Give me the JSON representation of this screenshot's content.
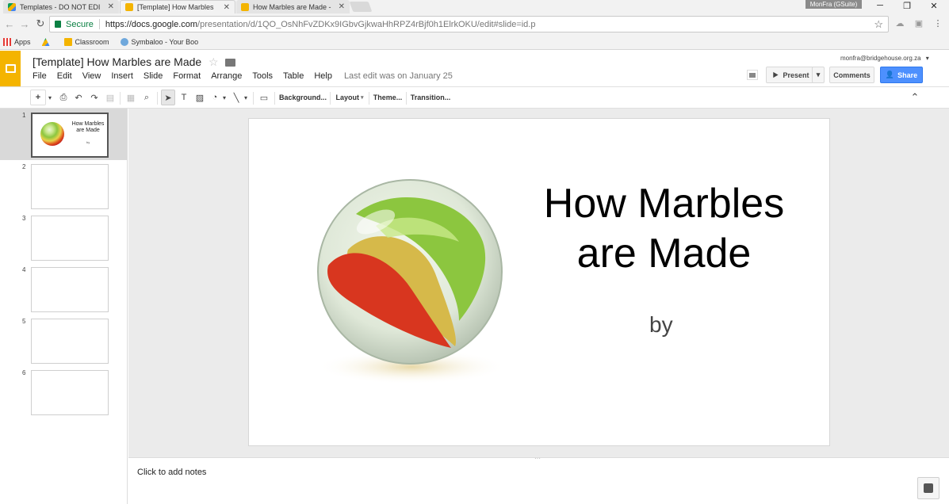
{
  "browser": {
    "tabs": [
      {
        "title": "Templates - DO NOT EDI",
        "active": false
      },
      {
        "title": "[Template] How Marbles",
        "active": true
      },
      {
        "title": "How Marbles are Made -",
        "active": false
      }
    ],
    "profile_name": "MonFra (GSuite)",
    "url_secure_label": "Secure",
    "url_host": "https://docs.google.com",
    "url_path": "/presentation/d/1QO_OsNhFvZDKx9IGbvGjkwaHhRPZ4rBjf0h1ElrkOKU/edit#slide=id.p",
    "bookmarks": [
      {
        "label": "Apps",
        "icon": "apps-grid-icon"
      },
      {
        "label": "",
        "icon": "google-drive-icon"
      },
      {
        "label": "Classroom",
        "icon": "classroom-icon"
      },
      {
        "label": "Symbaloo - Your Boo",
        "icon": "symbaloo-icon"
      }
    ]
  },
  "doc": {
    "title": "[Template] How Marbles are Made",
    "menu": [
      "File",
      "Edit",
      "View",
      "Insert",
      "Slide",
      "Format",
      "Arrange",
      "Tools",
      "Table",
      "Help"
    ],
    "last_edit": "Last edit was on January 25",
    "account": "monfra@bridgehouse.org.za",
    "present_label": "Present",
    "comments_label": "Comments",
    "share_label": "Share"
  },
  "toolbar": {
    "background_label": "Background...",
    "layout_label": "Layout",
    "theme_label": "Theme...",
    "transition_label": "Transition..."
  },
  "filmstrip": {
    "slides": [
      {
        "number": "1",
        "title": "How Marbles are Made",
        "subtitle": "by",
        "selected": true
      },
      {
        "number": "2"
      },
      {
        "number": "3"
      },
      {
        "number": "4"
      },
      {
        "number": "5"
      },
      {
        "number": "6"
      }
    ]
  },
  "slide": {
    "title": "How Marbles are Made",
    "subtitle": "by"
  },
  "notes": {
    "placeholder": "Click to add notes"
  },
  "colors": {
    "slides_brand": "#f4b400",
    "share_blue": "#4d90fe",
    "secure_green": "#0b8043"
  }
}
